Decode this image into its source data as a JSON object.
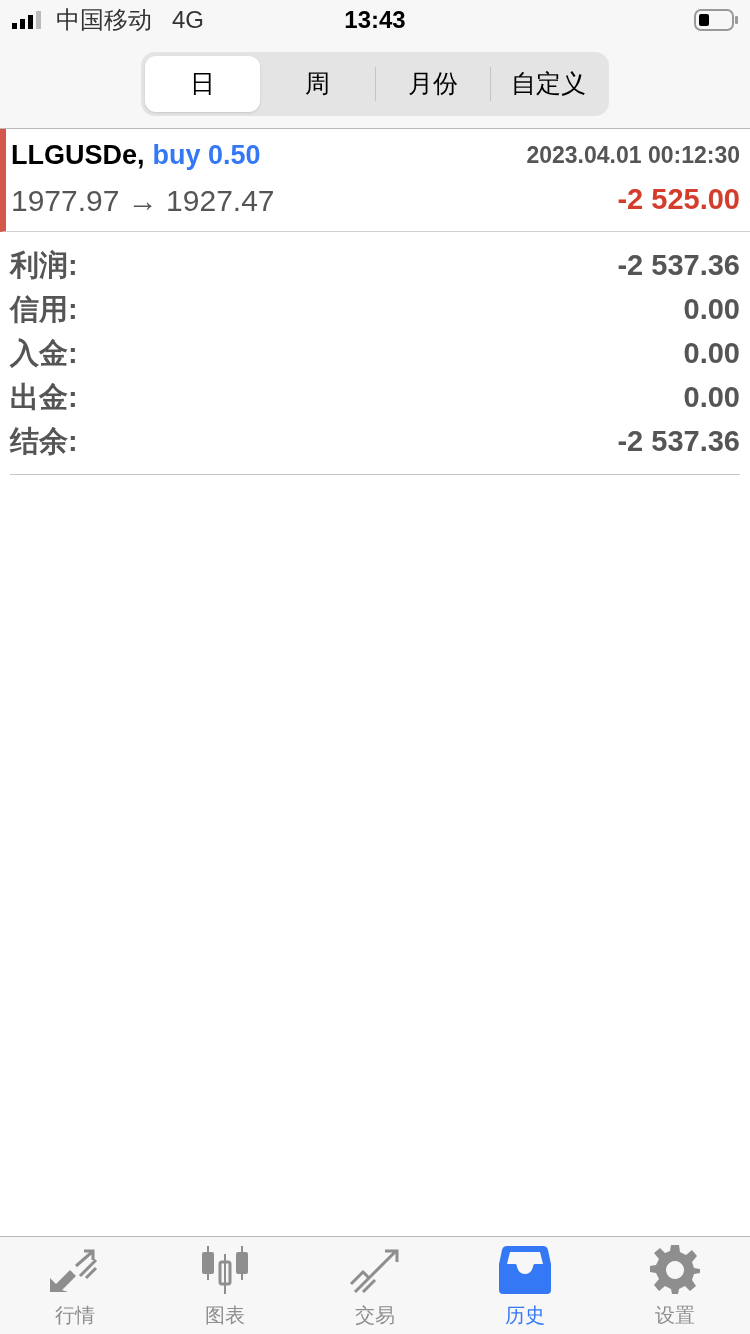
{
  "status_bar": {
    "carrier": "中国移动",
    "network": "4G",
    "time": "13:43"
  },
  "periods": [
    {
      "label": "日",
      "selected": true
    },
    {
      "label": "周",
      "selected": false
    },
    {
      "label": "月份",
      "selected": false
    },
    {
      "label": "自定义",
      "selected": false
    }
  ],
  "trade": {
    "symbol": "LLGUSDe,",
    "side": "buy 0.50",
    "time": "2023.04.01 00:12:30",
    "prices": "1977.97 → 1927.47",
    "profit": "-2 525.00",
    "loss": true
  },
  "summary": [
    {
      "label": "利润:",
      "value": "-2 537.36"
    },
    {
      "label": "信用:",
      "value": "0.00"
    },
    {
      "label": "入金:",
      "value": "0.00"
    },
    {
      "label": "出金:",
      "value": "0.00"
    },
    {
      "label": "结余:",
      "value": "-2 537.36"
    }
  ],
  "tab_bar": [
    {
      "kind": "quotes",
      "label": "行情",
      "selected": false
    },
    {
      "kind": "chart",
      "label": "图表",
      "selected": false
    },
    {
      "kind": "trade",
      "label": "交易",
      "selected": false
    },
    {
      "kind": "history",
      "label": "历史",
      "selected": true
    },
    {
      "kind": "settings",
      "label": "设置",
      "selected": false
    }
  ]
}
